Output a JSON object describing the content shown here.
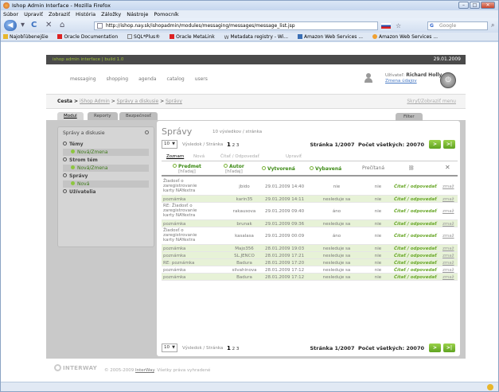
{
  "window": {
    "title": "Ishop Admin Interface - Mozilla Firefox",
    "controls": [
      "–",
      "□",
      "✕"
    ]
  },
  "menu": [
    "Súbor",
    "Upraviť",
    "Zobraziť",
    "História",
    "Záložky",
    "Nástroje",
    "Pomocník"
  ],
  "nav": {
    "url": "http://ishop.nay.sk/ishopadmin/modules/messaging/messages/message_list.jsp",
    "search_placeholder": "Google",
    "search_engine": "G"
  },
  "bookmarks": [
    "Najobľúbenejšie",
    "Oracle Documentation",
    "SQL*Plus®",
    "Oracle MetaLink",
    "Metadata registry - Wi...",
    "Amazon Web Services ...",
    "Amazon Web Services ..."
  ],
  "page": {
    "strip_label": "ishop admin interface | build 1.0",
    "date": "29.01.2009",
    "main_nav": [
      "messaging",
      "shopping",
      "agenda",
      "catalog",
      "users"
    ],
    "user": {
      "prefix": "Užívateľ:",
      "name": "Richard Holly",
      "link": "Zmena údajov"
    },
    "breadcrumb": {
      "label": "Cesta >",
      "items": [
        "iShop Admin",
        "Správy a diskusie",
        "Správy"
      ],
      "right": "Skryť/Zobraziť menu"
    },
    "tabs": [
      "Modul",
      "Reporty",
      "Bezpečnosť"
    ],
    "filter_tab": "Filter",
    "sidebar": {
      "title": "Správy a diskusie",
      "groups": [
        {
          "label": "Témy",
          "sub": "Nová/Zmena"
        },
        {
          "label": "Strom tém",
          "sub": "Nová/Zmena"
        },
        {
          "label": "Správy",
          "sub": "Nová"
        },
        {
          "label": "Užívatelia",
          "sub": ""
        }
      ]
    },
    "panel": {
      "title": "Správy",
      "count": "10 výsledkov / stránka",
      "per_page": "10",
      "per_page_label": "Výsledok / Stránka",
      "pages": [
        "1",
        "2",
        "3"
      ],
      "page_info": "Stránka 1/2007",
      "total_label": "Počet všetkých: 20070",
      "next": ">",
      "last": ">|"
    },
    "subtabs": [
      "Zoznam",
      "Nová",
      "Čítať / Odpovedať",
      "Upraviť"
    ],
    "columns": [
      {
        "label": "Predmet",
        "sub": "[hľadaj]"
      },
      {
        "label": "Autor",
        "sub": "[hľadaj]"
      },
      {
        "label": "Vytvorená",
        "sub": ""
      },
      {
        "label": "Vybavená",
        "sub": ""
      },
      {
        "label": "Prečítaná",
        "sub": ""
      },
      {
        "label": "⛓",
        "sub": ""
      },
      {
        "label": "✕",
        "sub": ""
      }
    ],
    "rows": [
      {
        "subject": [
          "Žiadosť o",
          "zaregistrovanie",
          "karty NAYextra"
        ],
        "author": "jbido",
        "created": "29.01.2009 14:40",
        "handled": "nie",
        "read": "nie",
        "action": "Čítať / odpovedať",
        "del": "zmaž",
        "note": false
      },
      {
        "subject": [
          "poznámka"
        ],
        "author": "karin35",
        "created": "29.01.2009 14:11",
        "handled": "nesleduje sa",
        "read": "nie",
        "action": "Čítať / odpovedať",
        "del": "zmaž",
        "note": true
      },
      {
        "subject": [
          "RE: Žiadosť o",
          "zaregistrovanie",
          "karty NAYextra"
        ],
        "author": "rakausova",
        "created": "29.01.2009 09:40",
        "handled": "áno",
        "read": "nie",
        "action": "Čítať / odpovedať",
        "del": "zmaž",
        "note": false
      },
      {
        "subject": [
          "poznámka"
        ],
        "author": "brunak",
        "created": "29.01.2009 09:36",
        "handled": "nesleduje sa",
        "read": "nie",
        "action": "Čítať / odpovedať",
        "del": "zmaž",
        "note": true
      },
      {
        "subject": [
          "Žiadosť o",
          "zaregistrovanie",
          "karty NAYextra"
        ],
        "author": "kasalasa",
        "created": "29.01.2009 00:09",
        "handled": "áno",
        "read": "nie",
        "action": "Čítať / odpovedať",
        "del": "zmaž",
        "note": false
      },
      {
        "subject": [
          "poznámka"
        ],
        "author": "Majo356",
        "created": "28.01.2009 19:03",
        "handled": "nesleduje sa",
        "read": "nie",
        "action": "Čítať / odpovedať",
        "del": "zmaž",
        "note": true
      },
      {
        "subject": [
          "poznámka"
        ],
        "author": "SL.JENCO",
        "created": "28.01.2009 17:21",
        "handled": "nesleduje sa",
        "read": "nie",
        "action": "Čítať / odpovedať",
        "del": "zmaž",
        "note": true
      },
      {
        "subject": [
          "RE: poznámka"
        ],
        "author": "Badura",
        "created": "28.01.2009 17:20",
        "handled": "nesleduje sa",
        "read": "nie",
        "action": "Čítať / odpovedať",
        "del": "zmaž",
        "note": true
      },
      {
        "subject": [
          "poznámka"
        ],
        "author": "silvahinova",
        "created": "28.01.2009 17:12",
        "handled": "nesleduje sa",
        "read": "nie",
        "action": "Čítať / odpovedať",
        "del": "zmaž",
        "note": false
      },
      {
        "subject": [
          "poznámka"
        ],
        "author": "Badura",
        "created": "28.01.2009 17:12",
        "handled": "nesleduje sa",
        "read": "nie",
        "action": "Čítať / odpovedať",
        "del": "zmaž",
        "note": true
      }
    ],
    "footer": {
      "logo": "INTERWAY",
      "copy": "© 2005-2009",
      "company": "InterWay",
      "rights": ". Všetky práva vyhradené"
    }
  },
  "colors": {
    "accent_green": "#8dc63f",
    "dark_strip": "#4a4a4a",
    "firefox_chrome": "#c8d8ec"
  }
}
